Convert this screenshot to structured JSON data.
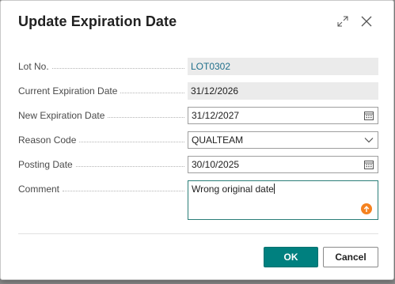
{
  "dialog": {
    "title": "Update Expiration Date",
    "header_icons": [
      "expand-icon",
      "close-icon"
    ]
  },
  "fields": {
    "lot_no": {
      "label": "Lot No.",
      "value": "LOT0302"
    },
    "current_expiration_date": {
      "label": "Current Expiration Date",
      "value": "31/12/2026"
    },
    "new_expiration_date": {
      "label": "New Expiration Date",
      "value": "31/12/2027",
      "icon": "calendar-icon"
    },
    "reason_code": {
      "label": "Reason Code",
      "value": "QUALTEAM",
      "icon": "chevron-down-icon"
    },
    "posting_date": {
      "label": "Posting Date",
      "value": "30/10/2025",
      "icon": "calendar-icon"
    },
    "comment": {
      "label": "Comment",
      "value": "Wrong original date",
      "icon": "upload-icon"
    }
  },
  "buttons": {
    "ok": "OK",
    "cancel": "Cancel"
  },
  "colors": {
    "accent": "#00807f",
    "link": "#1f6f8b",
    "readonly_bg": "#ebebeb",
    "badge": "#f5821f"
  }
}
